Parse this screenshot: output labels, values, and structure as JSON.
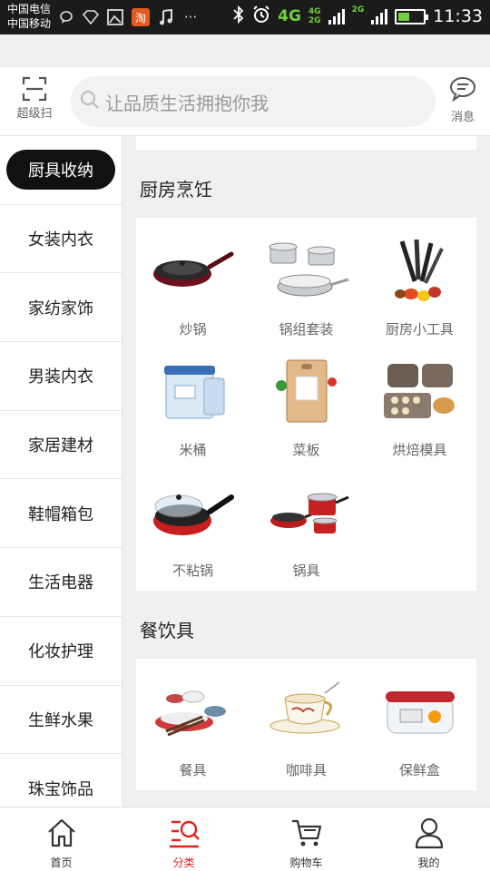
{
  "status_bar": {
    "carrier_1": "中国电信",
    "carrier_2": "中国移动",
    "network": "4G",
    "network_small_top": "4G",
    "network_small_bottom": "2G",
    "network_2g": "2G",
    "time": "11:33",
    "icons": [
      "chat-bubble-icon",
      "wifi-diamond-icon",
      "image-icon",
      "taobao-icon",
      "music-icon",
      "more-icon",
      "bluetooth-icon",
      "alarm-icon",
      "signal-icon",
      "battery-charging-icon"
    ],
    "taobao_glyph": "淘",
    "more_glyph": "···"
  },
  "header": {
    "scan_label": "超级扫",
    "search_placeholder": "让品质生活拥抱你我",
    "message_label": "消息"
  },
  "sidebar": {
    "items": [
      {
        "label": "厨具收纳",
        "active": true
      },
      {
        "label": "女装内衣"
      },
      {
        "label": "家纺家饰"
      },
      {
        "label": "男装内衣"
      },
      {
        "label": "家居建材"
      },
      {
        "label": "鞋帽箱包"
      },
      {
        "label": "生活电器"
      },
      {
        "label": "化妆护理"
      },
      {
        "label": "生鲜水果"
      },
      {
        "label": "珠宝饰品"
      }
    ]
  },
  "sections": [
    {
      "title": "厨房烹饪",
      "products": [
        {
          "label": "炒锅",
          "icon": "frying-pan-icon"
        },
        {
          "label": "锅组套装",
          "icon": "pot-set-icon"
        },
        {
          "label": "厨房小工具",
          "icon": "knife-set-icon"
        },
        {
          "label": "米桶",
          "icon": "rice-bin-icon"
        },
        {
          "label": "菜板",
          "icon": "cutting-board-icon"
        },
        {
          "label": "烘焙模具",
          "icon": "baking-mold-icon"
        },
        {
          "label": "不粘锅",
          "icon": "nonstick-pan-icon"
        },
        {
          "label": "锅具",
          "icon": "cookware-icon"
        }
      ]
    },
    {
      "title": "餐饮具",
      "products": [
        {
          "label": "餐具",
          "icon": "tableware-icon"
        },
        {
          "label": "咖啡具",
          "icon": "coffee-cup-icon"
        },
        {
          "label": "保鲜盒",
          "icon": "food-container-icon"
        }
      ]
    }
  ],
  "tabbar": {
    "items": [
      {
        "label": "首页",
        "icon": "home-icon"
      },
      {
        "label": "分类",
        "icon": "category-icon",
        "active": true
      },
      {
        "label": "购物车",
        "icon": "cart-icon"
      },
      {
        "label": "我的",
        "icon": "profile-icon"
      }
    ]
  },
  "colors": {
    "accent": "#e0241b",
    "active_pill": "#111111",
    "status_bar": "#1b1b1b"
  }
}
